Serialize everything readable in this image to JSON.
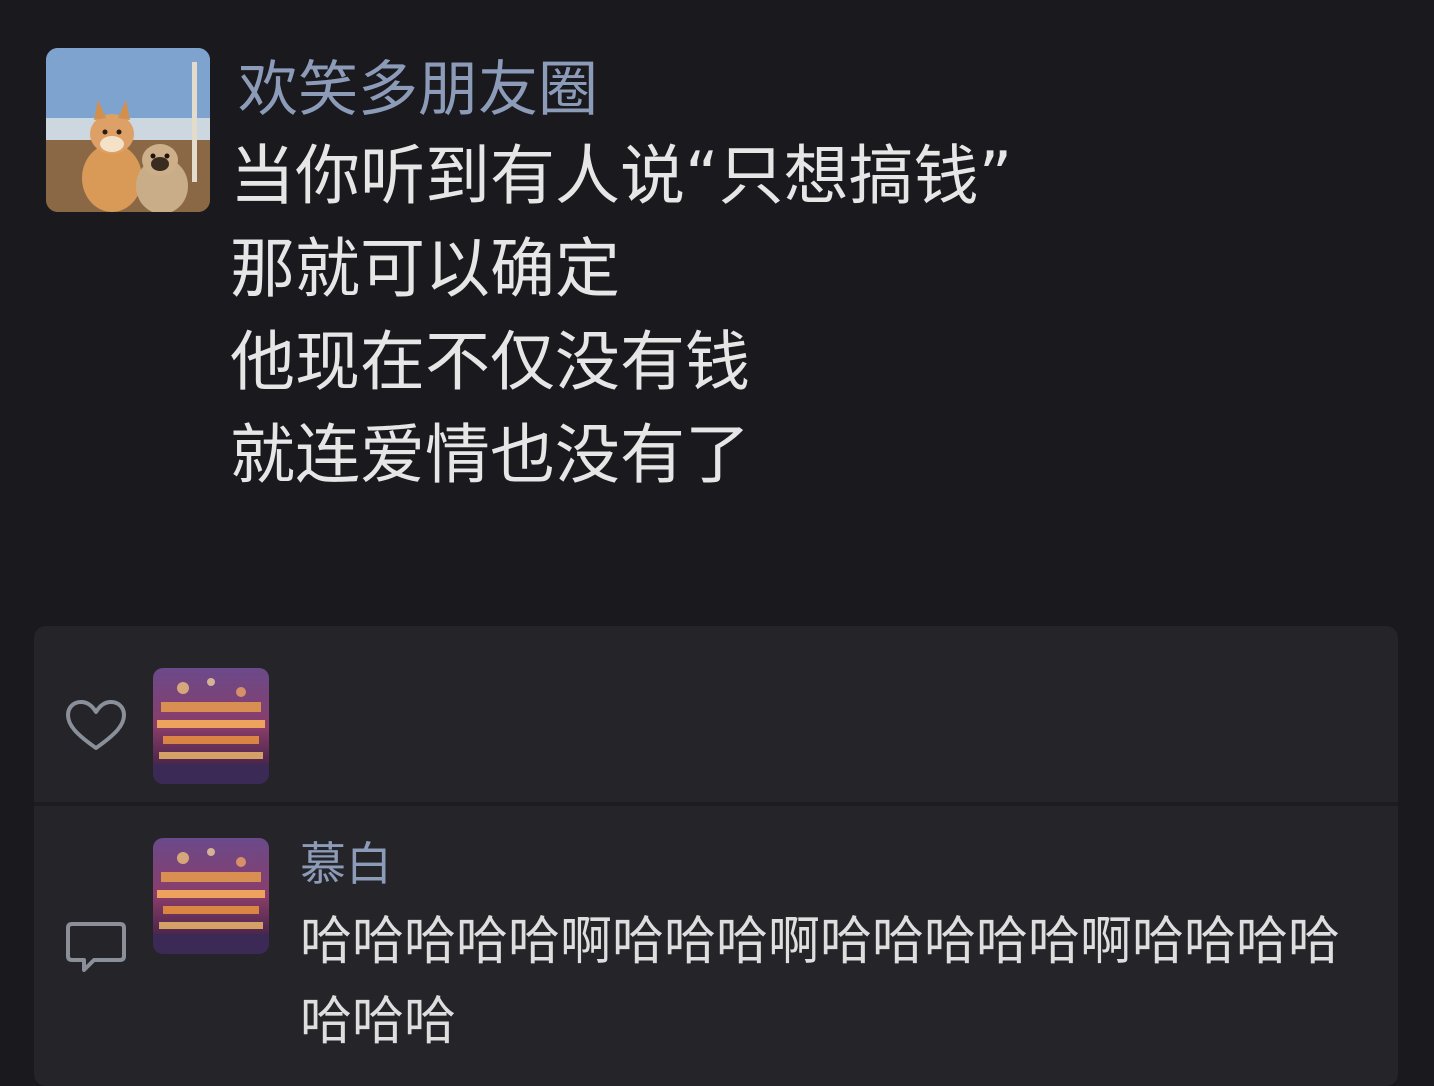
{
  "post": {
    "author": "欢笑多朋友圈",
    "lines": [
      "当你听到有人说“只想搞钱”",
      "那就可以确定",
      "他现在不仅没有钱",
      "就连爱情也没有了"
    ]
  },
  "likes": {
    "icon": "heart-outline-icon"
  },
  "comments": [
    {
      "name": "慕白",
      "text": "哈哈哈哈哈啊哈哈哈啊哈哈哈哈哈啊哈哈哈哈哈哈哈"
    }
  ],
  "colors": {
    "background": "#1a191d",
    "panel": "#252429",
    "name_link": "#8b9bb8",
    "text": "#e6e6e6"
  }
}
